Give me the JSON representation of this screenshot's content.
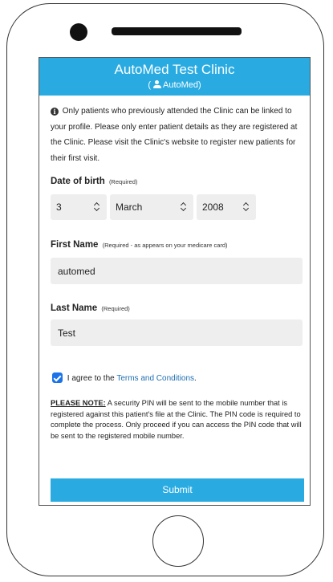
{
  "header": {
    "title": "AutoMed Test Clinic",
    "sub_open": "(",
    "sub_user": "AutoMed",
    "sub_close": ")"
  },
  "info_text": "Only patients who previously attended the Clinic can be linked to your profile. Please only enter patient details as they are registered at the Clinic. Please visit the Clinic's website to register new patients for their first visit.",
  "dob": {
    "label": "Date of birth",
    "required": "(Required)",
    "day": "3",
    "month": "March",
    "year": "2008"
  },
  "first_name": {
    "label": "First Name",
    "required": "(Required - as appears on your medicare card)",
    "value": "automed"
  },
  "last_name": {
    "label": "Last Name",
    "required": "(Required)",
    "value": "Test"
  },
  "agree": {
    "checked": true,
    "text": "I agree to the",
    "link": "Terms and Conditions",
    "end": "."
  },
  "note": {
    "heading": "PLEASE NOTE:",
    "text": "A security PIN will be sent to the mobile number that is registered against this patient's file at the Clinic. The PIN code is required to complete the process. Only proceed if you can access the PIN code that will be sent to the registered mobile number."
  },
  "submit_label": "Submit",
  "colors": {
    "accent": "#29abe2",
    "link": "#1f6fb2",
    "checkbox": "#1a73e8",
    "input_bg": "#eeeeee"
  },
  "icons": {
    "info": "info-circle-icon",
    "user": "user-icon",
    "select": "chevron-up-down-icon"
  }
}
